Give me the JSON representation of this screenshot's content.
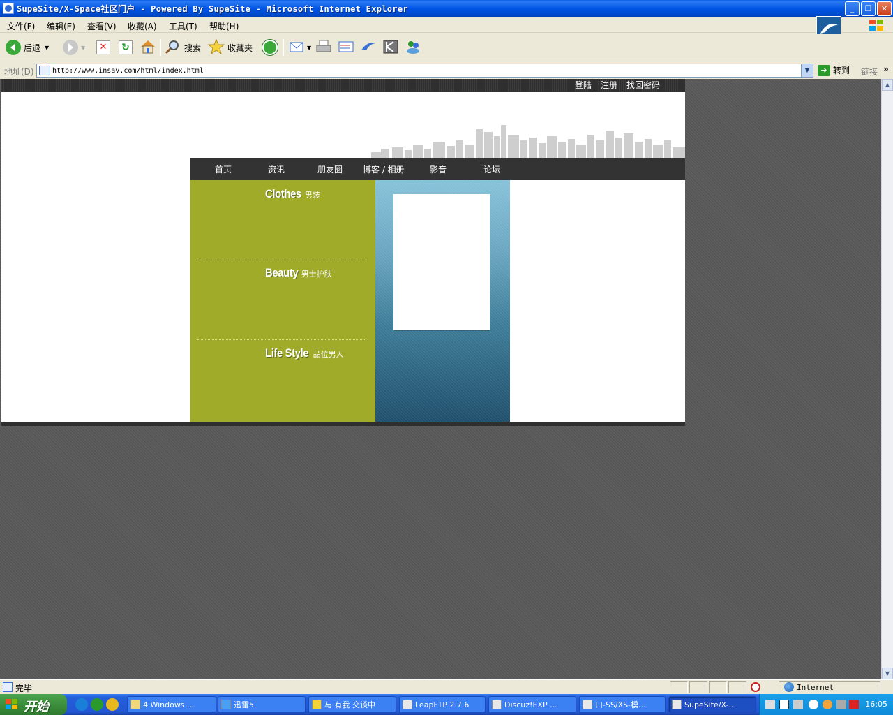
{
  "window": {
    "title": "SupeSite/X-Space社区门户 - Powered By SupeSite - Microsoft Internet Explorer",
    "minimize": "_",
    "restore": "❐",
    "close": "✕"
  },
  "menubar": {
    "items": [
      "文件(F)",
      "编辑(E)",
      "查看(V)",
      "收藏(A)",
      "工具(T)",
      "帮助(H)"
    ]
  },
  "toolbar": {
    "back_label": "后退",
    "search_label": "搜索",
    "favorites_label": "收藏夹"
  },
  "addressbar": {
    "label": "地址(D)",
    "url": "http://www.insav.com/html/index.html",
    "go_label": "转到",
    "links_label": "链接"
  },
  "site": {
    "top_links": [
      "登陆",
      "注册",
      "找回密码"
    ],
    "nav": [
      "首页",
      "资讯",
      "朋友圈",
      "博客 / 相册",
      "影音",
      "论坛"
    ],
    "categories": [
      {
        "en": "Clothes",
        "zh": "男装"
      },
      {
        "en": "Beauty",
        "zh": "男士护肤"
      },
      {
        "en": "Life Style",
        "zh": "品位男人"
      }
    ]
  },
  "status": {
    "text": "完毕",
    "zone": "Internet"
  },
  "taskbar": {
    "start_label": "开始",
    "tasks": [
      "4 Windows ...",
      "迅雷5",
      "与 有我 交谈中",
      "LeapFTP 2.7.6",
      "Discuz!EXP ...",
      "口-SS/XS-模...",
      "SupeSite/X-..."
    ],
    "clock": "16:05"
  },
  "colors": {
    "accent_green": "#a1ab2a",
    "nav_bg": "#333333",
    "page_bg": "#5d5d5d"
  }
}
